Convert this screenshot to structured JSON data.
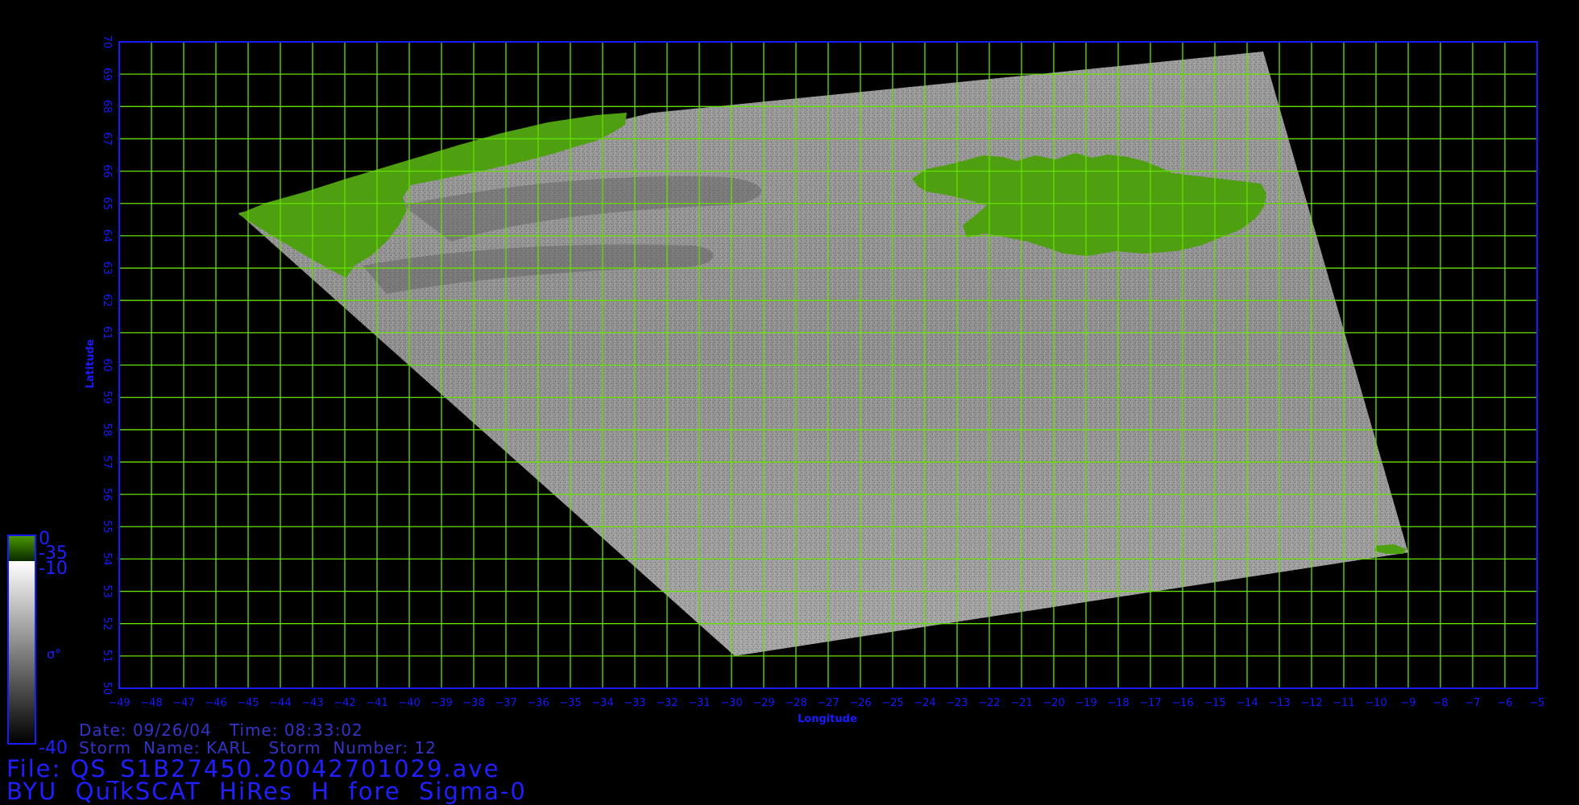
{
  "colors": {
    "background": "#000000",
    "grid": "#66e000",
    "frame": "#1a1aff",
    "label": "#1a1aff",
    "land": "#4fa010"
  },
  "map": {
    "lon_ticks": [
      -49,
      -48,
      -47,
      -46,
      -45,
      -44,
      -43,
      -42,
      -41,
      -40,
      -39,
      -38,
      -37,
      -36,
      -35,
      -34,
      -33,
      -32,
      -31,
      -30,
      -29,
      -28,
      -27,
      -26,
      -25,
      -24,
      -23,
      -22,
      -21,
      -20,
      -19,
      -18,
      -17,
      -16,
      -15,
      -14,
      -13,
      -12,
      -11,
      -10,
      -9,
      -8,
      -7,
      -6,
      -5
    ],
    "lat_ticks": [
      50,
      51,
      52,
      53,
      54,
      55,
      56,
      57,
      58,
      59,
      60,
      61,
      62,
      63,
      64,
      65,
      66,
      67,
      68,
      69,
      70
    ],
    "xlabel": "Longitude",
    "ylabel": "Latitude",
    "lon_range": [
      -49,
      -5
    ],
    "lat_range": [
      50,
      70
    ],
    "swath_corners_lonlat": [
      [
        -45.3,
        64.7
      ],
      [
        -32.5,
        67.8
      ],
      [
        -13.5,
        69.7
      ],
      [
        -9.0,
        54.2
      ],
      [
        -29.9,
        51.0
      ]
    ],
    "colorbar": {
      "land_top": "0",
      "land_bottom": "-35",
      "ocean_top": "-10",
      "ocean_bottom": "-40",
      "symbol": "σ°"
    }
  },
  "info": {
    "date_line": "Date: 09/26/04   Time: 08:33:02",
    "storm_line": "Storm  Name: KARL   Storm  Number: 12",
    "file_line": "File: QS_S1B27450.20042701029.ave",
    "product_line": "BYU  QuikSCAT  HiRes  H  fore  Sigma-0"
  }
}
